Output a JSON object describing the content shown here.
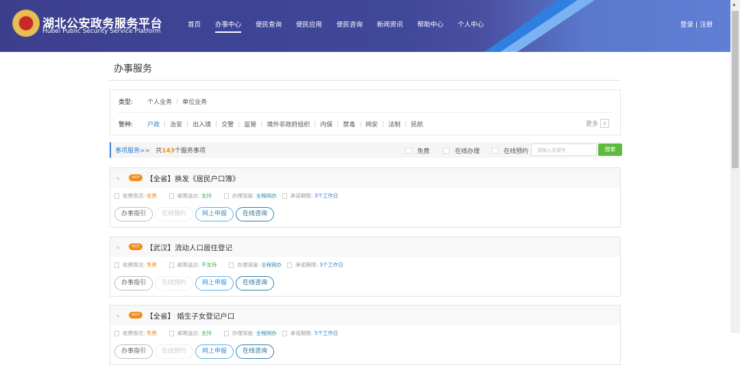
{
  "header": {
    "title": "湖北公安政务服务平台",
    "subtitle": "Hubei Public Security Service Platform",
    "nav": [
      "首页",
      "办事中心",
      "便民查询",
      "便民应用",
      "便民咨询",
      "新闻资讯",
      "帮助中心",
      "个人中心"
    ],
    "login": "登录 | 注册"
  },
  "page_title": "办事服务",
  "filter": {
    "type_label": "类型:",
    "types": [
      "个人业务",
      "单位业务"
    ],
    "police_label": "警种:",
    "police": [
      "户政",
      "治安",
      "出入境",
      "交警",
      "监管",
      "境外非政府组织",
      "内保",
      "禁毒",
      "网安",
      "法制",
      "民航"
    ],
    "more": "更多"
  },
  "bar": {
    "section": "事项服务>>",
    "count_prefix": "共",
    "count": "143",
    "count_suffix": "个服务事项",
    "checks": [
      "免费",
      "在线办理",
      "在线预约"
    ],
    "search_placeholder": "请输入关键字",
    "search_btn": "搜索"
  },
  "hot": "HOT",
  "labels": {
    "fee": "收费情况:",
    "mail": "邮寄送达:",
    "depth": "办理深度:",
    "limit": "承诺期限:"
  },
  "buttons": [
    "办事指引",
    "在线预约",
    "网上申报",
    "在线咨询"
  ],
  "cards": [
    {
      "title": "【全省】换发《居民户口簿》",
      "fee": "收费",
      "mail": "支持",
      "depth": "全程网办",
      "limit": "3个工作日"
    },
    {
      "title": "【武汉】流动人口居住登记",
      "fee": "免费",
      "mail": "不支持",
      "depth": "全程网办",
      "limit": "3个工作日"
    },
    {
      "title": "【全省】 婚生子女登记户口",
      "fee": "免费",
      "mail": "支持",
      "depth": "全程网办",
      "limit": "5个工作日"
    }
  ]
}
